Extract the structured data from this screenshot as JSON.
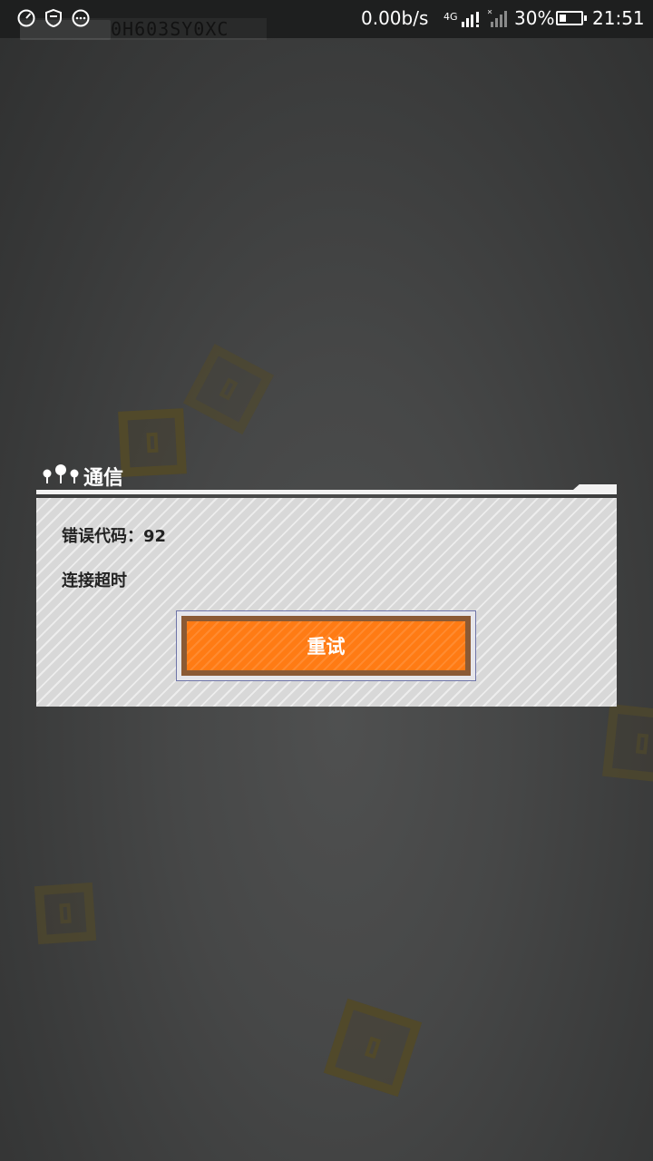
{
  "status_bar": {
    "game_id": "0H603SY0XC",
    "net_speed": "0.00b/s",
    "net_type": "4G",
    "battery_percent": "30%",
    "battery_level": 0.3,
    "time": "21:51"
  },
  "dialog": {
    "title": "通信",
    "error_code_line": "错误代码：92",
    "message": "连接超时",
    "retry_label": "重试"
  },
  "colors": {
    "button_orange": "#ff7b14",
    "button_border": "#8b5a34",
    "panel_bg": "#d8d8d8",
    "background": "#464747"
  }
}
